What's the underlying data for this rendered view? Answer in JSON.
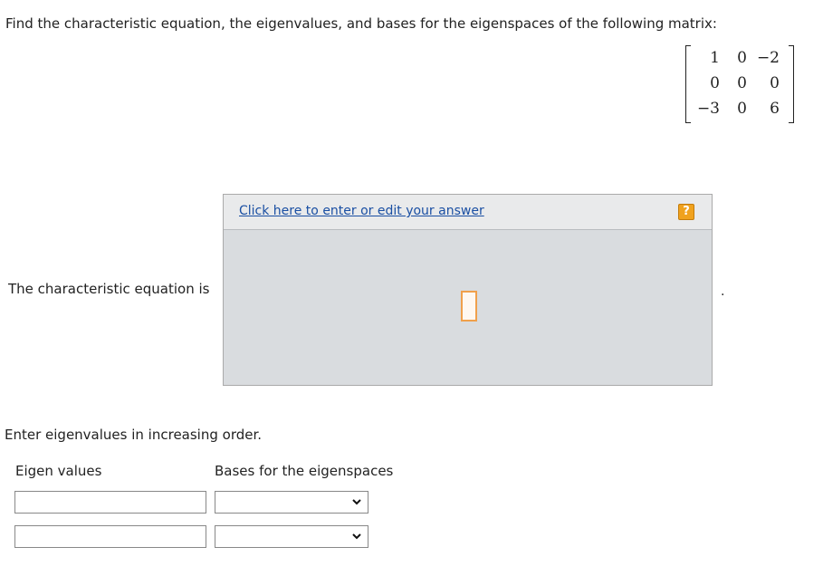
{
  "question": "Find the characteristic equation, the eigenvalues, and bases for the eigenspaces of the following matrix:",
  "matrix": {
    "rows": [
      [
        "1",
        "0",
        "−2"
      ],
      [
        "0",
        "0",
        "0"
      ],
      [
        "−3",
        "0",
        "6"
      ]
    ]
  },
  "characteristic": {
    "label": "The characteristic equation is",
    "edit_link": "Click here to enter or edit your answer",
    "help_icon": "question-icon",
    "trailing": "."
  },
  "eigen": {
    "order_note": "Enter eigenvalues in increasing order.",
    "eigen_header": "Eigen values",
    "basis_header": "Bases for the eigenspaces",
    "rows": [
      {
        "eigen_value": "",
        "basis_selected": ""
      },
      {
        "eigen_value": "",
        "basis_selected": ""
      }
    ]
  }
}
